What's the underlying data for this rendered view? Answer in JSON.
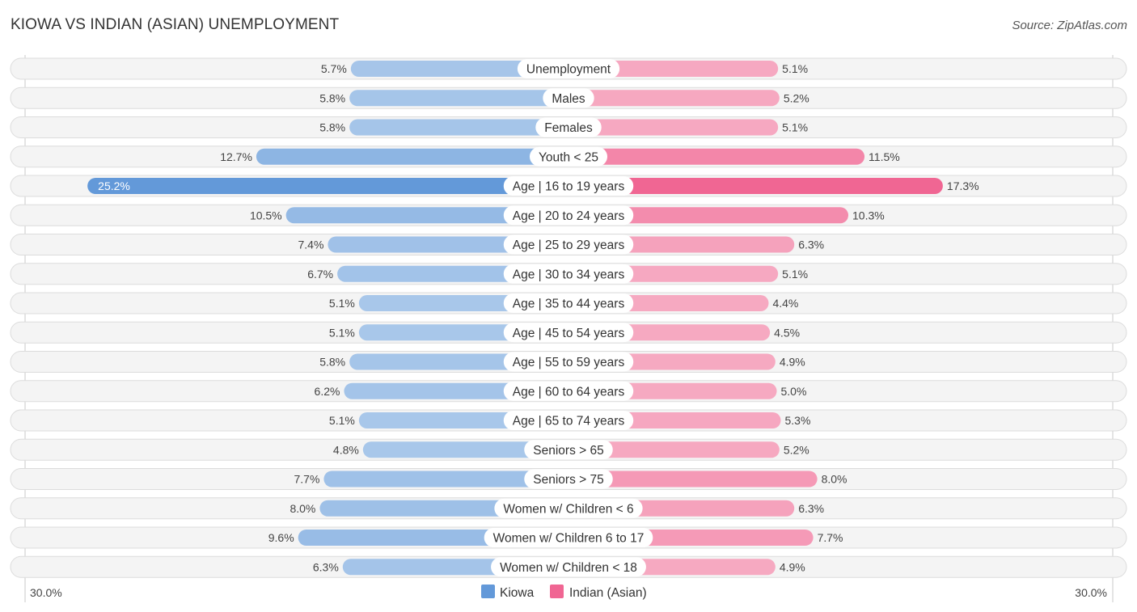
{
  "header": {
    "title": "KIOWA VS INDIAN (ASIAN) UNEMPLOYMENT",
    "source": "Source: ZipAtlas.com"
  },
  "colors": {
    "kiowa": "#a8c7ea",
    "kiowa_strong": "#6399d9",
    "indian": "#f6a9c1",
    "indian_strong": "#f06693"
  },
  "chart_data": {
    "type": "bar",
    "orientation": "horizontal-diverging",
    "title": "KIOWA VS INDIAN (ASIAN) UNEMPLOYMENT",
    "xlabel": "",
    "ylabel": "",
    "xlim": [
      -30,
      30
    ],
    "axis_labels": {
      "left": "30.0%",
      "right": "30.0%"
    },
    "legend": {
      "placement": "bottom-center",
      "entries": [
        "Kiowa",
        "Indian (Asian)"
      ]
    },
    "categories": [
      "Unemployment",
      "Males",
      "Females",
      "Youth < 25",
      "Age | 16 to 19 years",
      "Age | 20 to 24 years",
      "Age | 25 to 29 years",
      "Age | 30 to 34 years",
      "Age | 35 to 44 years",
      "Age | 45 to 54 years",
      "Age | 55 to 59 years",
      "Age | 60 to 64 years",
      "Age | 65 to 74 years",
      "Seniors > 65",
      "Seniors > 75",
      "Women w/ Children < 6",
      "Women w/ Children 6 to 17",
      "Women w/ Children < 18"
    ],
    "series": [
      {
        "name": "Kiowa",
        "side": "left",
        "values": [
          5.7,
          5.8,
          5.8,
          12.7,
          25.2,
          10.5,
          7.4,
          6.7,
          5.1,
          5.1,
          5.8,
          6.2,
          5.1,
          4.8,
          7.7,
          8.0,
          9.6,
          6.3
        ],
        "labels": [
          "5.7%",
          "5.8%",
          "5.8%",
          "12.7%",
          "25.2%",
          "10.5%",
          "7.4%",
          "6.7%",
          "5.1%",
          "5.1%",
          "5.8%",
          "6.2%",
          "5.1%",
          "4.8%",
          "7.7%",
          "8.0%",
          "9.6%",
          "6.3%"
        ]
      },
      {
        "name": "Indian (Asian)",
        "side": "right",
        "values": [
          5.1,
          5.2,
          5.1,
          11.5,
          17.3,
          10.3,
          6.3,
          5.1,
          4.4,
          4.5,
          4.9,
          5.0,
          5.3,
          5.2,
          8.0,
          6.3,
          7.7,
          4.9
        ],
        "labels": [
          "5.1%",
          "5.2%",
          "5.1%",
          "11.5%",
          "17.3%",
          "10.3%",
          "6.3%",
          "5.1%",
          "4.4%",
          "4.5%",
          "4.9%",
          "5.0%",
          "5.3%",
          "5.2%",
          "8.0%",
          "6.3%",
          "7.7%",
          "4.9%"
        ]
      }
    ]
  }
}
